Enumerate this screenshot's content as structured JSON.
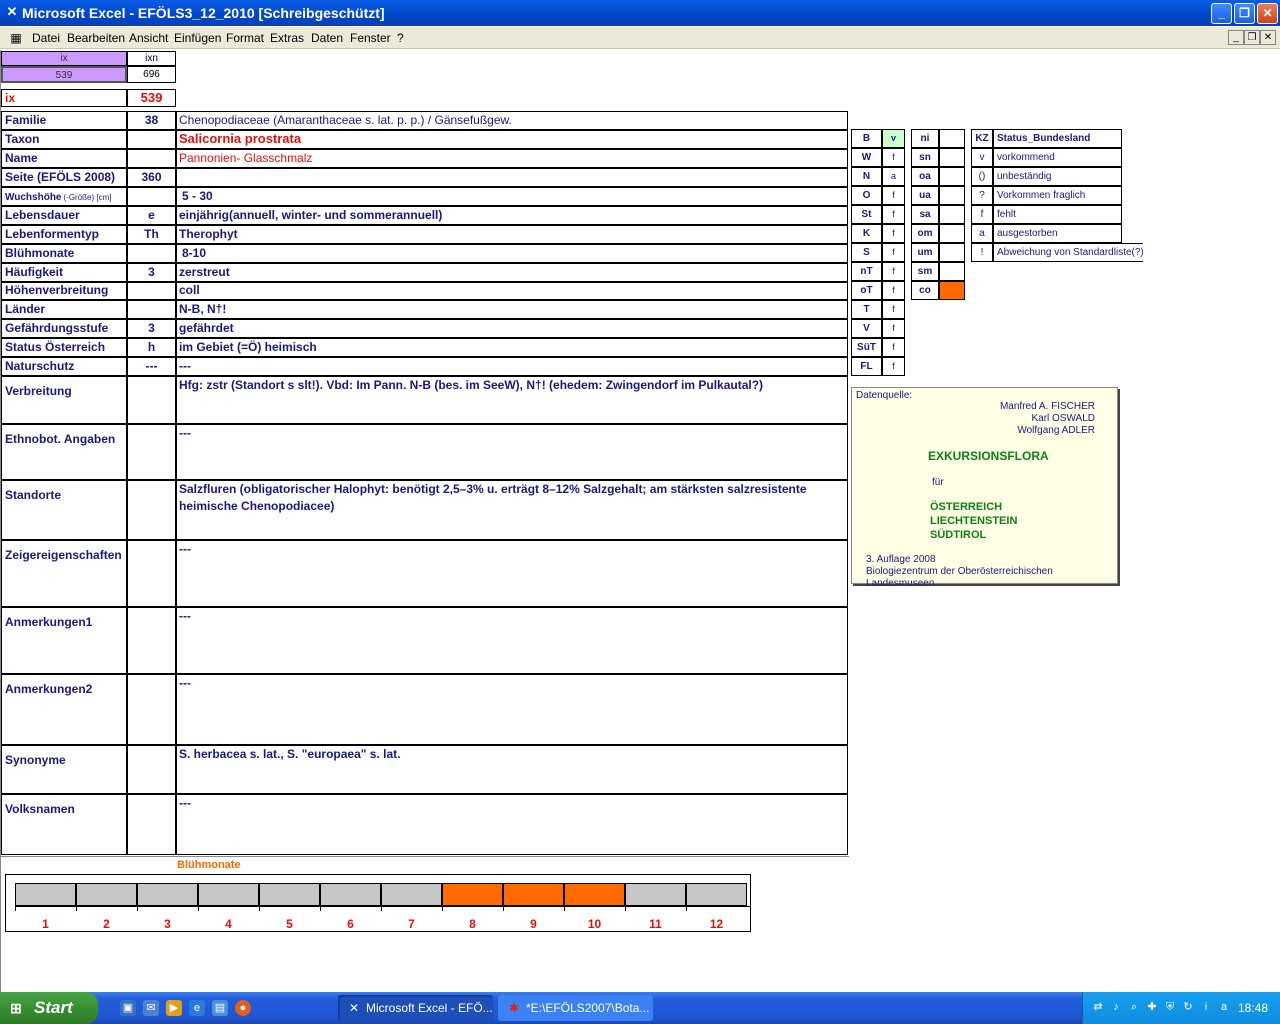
{
  "window": {
    "title": "Microsoft Excel - EFÖLS3_12_2010  [Schreibgeschützt]",
    "minimize": "_",
    "maximize": "❐",
    "close": "✕"
  },
  "menu": {
    "items": [
      "Datei",
      "Bearbeiten",
      "Ansicht",
      "Einfügen",
      "Format",
      "Extras",
      "Daten",
      "Fenster",
      "?"
    ],
    "mdi_min": "_",
    "mdi_restore": "❐",
    "mdi_close": "✕"
  },
  "header": {
    "ix_label": "ix",
    "ixn_label": "ixn",
    "ix_value": "539",
    "ixn_value": "696",
    "ix_big_label": "ix",
    "ix_big_value": "539"
  },
  "fields": [
    {
      "label": "Familie",
      "code": "38",
      "value": "Chenopodiaceae (Amaranthaceae s. lat. p. p.)  /  Gänsefußgew."
    },
    {
      "label": "Taxon",
      "code": "",
      "value": "Salicornia prostrata"
    },
    {
      "label": "Name",
      "code": "",
      "value": "Pannonien- Glasschmalz"
    },
    {
      "label": "Seite (EFÖLS 2008)",
      "code": "360",
      "value": ""
    },
    {
      "label": "Wuchshöhe",
      "label_small": "(-Größe) [cm]",
      "code": "",
      "value": "5 - 30"
    },
    {
      "label": "Lebensdauer",
      "code": "e",
      "value": "einjährig(annuell, winter- und sommerannuell)"
    },
    {
      "label": "Lebenformentyp",
      "code": "Th",
      "value": "Therophyt"
    },
    {
      "label": "Blühmonate",
      "code": "",
      "value": "8-10"
    },
    {
      "label": "Häufigkeit",
      "code": "3",
      "value": "zerstreut"
    },
    {
      "label": "Höhenverbreitung",
      "code": "",
      "value": "coll"
    },
    {
      "label": "Länder",
      "code": "",
      "value": "N-B, N†!"
    },
    {
      "label": "Gefährdungsstufe",
      "code": "3",
      "value": "gefährdet"
    },
    {
      "label": "Status Österreich",
      "code": "h",
      "value": "im Gebiet (=Ö) heimisch"
    },
    {
      "label": "Naturschutz",
      "code": "---",
      "value": "---"
    },
    {
      "label": "Verbreitung",
      "code": "",
      "value": "Hfg: zstr (Standort s slt!).  Vbd:  Im Pann. N-B (bes. im SeeW), N†! (ehedem: Zwingendorf im Pulkautal?)"
    },
    {
      "label": "Ethnobot. Angaben",
      "code": "",
      "value": "---"
    },
    {
      "label": "Standorte",
      "code": "",
      "value": "Salzfluren (obligatorischer Halophyt: benötigt 2,5–3% u. erträgt 8–12% Salzgehalt; am stärksten salzresistente heimische Chenopodiacee)"
    },
    {
      "label": "Zeigereigenschaften",
      "code": "",
      "value": "---"
    },
    {
      "label": "Anmerkungen1",
      "code": "",
      "value": "---"
    },
    {
      "label": "Anmerkungen2",
      "code": "",
      "value": "---"
    },
    {
      "label": "Synonyme",
      "code": "",
      "value": "S. herbacea s. lat., S. \"europaea\" s. lat."
    },
    {
      "label": "Volksnamen",
      "code": "",
      "value": "---"
    }
  ],
  "states": [
    {
      "code": "B",
      "val": "v"
    },
    {
      "code": "W",
      "val": "f"
    },
    {
      "code": "N",
      "val": "a"
    },
    {
      "code": "O",
      "val": "f"
    },
    {
      "code": "St",
      "val": "f"
    },
    {
      "code": "K",
      "val": "f"
    },
    {
      "code": "S",
      "val": "f"
    },
    {
      "code": "nT",
      "val": "f"
    },
    {
      "code": "oT",
      "val": "f"
    },
    {
      "code": "T",
      "val": "f"
    },
    {
      "code": "V",
      "val": "f"
    },
    {
      "code": "SüT",
      "val": "f"
    },
    {
      "code": "FL",
      "val": "f"
    }
  ],
  "altitudes": [
    "ni",
    "sn",
    "oa",
    "ua",
    "sa",
    "om",
    "um",
    "sm",
    "co"
  ],
  "status_legend": {
    "kz_header": "KZ",
    "status_header": "Status_Bundesland",
    "rows": [
      {
        "kz": "v",
        "text": "vorkommend"
      },
      {
        "kz": "()",
        "text": "unbeständig"
      },
      {
        "kz": "?",
        "text": "Vorkommen fraglich"
      },
      {
        "kz": "f",
        "text": "fehlt"
      },
      {
        "kz": "a",
        "text": "ausgestorben"
      },
      {
        "kz": "!",
        "text": "Abweichung von Standardliste(?)"
      }
    ]
  },
  "source": {
    "label": "Datenquelle:",
    "authors": [
      "Manfred A. FISCHER",
      "Karl OSWALD",
      "Wolfgang ADLER"
    ],
    "title": "EXKURSIONSFLORA",
    "fuer": "für",
    "countries": [
      "ÖSTERREICH",
      "LIECHTENSTEIN",
      "SÜDTIROL"
    ],
    "edition": "3. Auflage 2008",
    "publisher": "Biologiezentrum der Oberösterreichischen Landesmuseen"
  },
  "bloom_chart": {
    "title": "Blühmonate",
    "months": [
      "1",
      "2",
      "3",
      "4",
      "5",
      "6",
      "7",
      "8",
      "9",
      "10",
      "11",
      "12"
    ],
    "flowering": [
      8,
      9,
      10
    ],
    "colors": {
      "on": "#ff6a00",
      "off": "#c6c6c6"
    }
  },
  "taskbar": {
    "start": "Start",
    "tasks": [
      "Microsoft Excel - EFÖ...",
      "*E:\\EFÖLS2007\\Bota..."
    ],
    "clock": "18:48"
  }
}
